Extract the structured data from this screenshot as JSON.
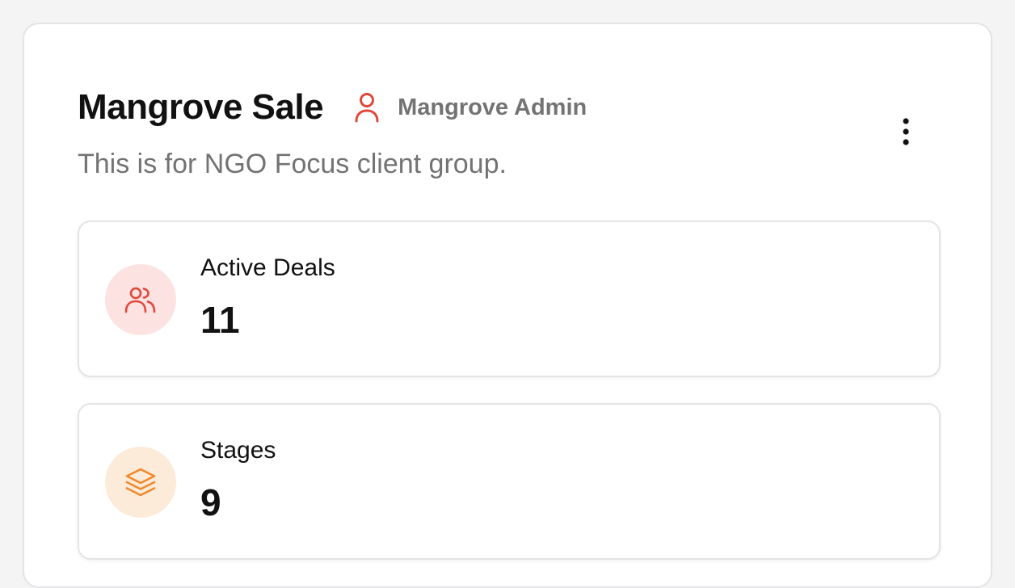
{
  "pipeline": {
    "title": "Mangrove Sale",
    "owner": "Mangrove Admin",
    "owner_icon": "user-icon",
    "description": "This is for NGO Focus client group.",
    "menu_icon": "more-vertical-icon"
  },
  "stats": [
    {
      "label": "Active Deals",
      "value": "11",
      "icon": "users-icon",
      "icon_color": "#e0483a",
      "icon_bg": "#fde2e2"
    },
    {
      "label": "Stages",
      "value": "9",
      "icon": "layers-icon",
      "icon_color": "#f0892e",
      "icon_bg": "#fdebd9"
    }
  ],
  "colors": {
    "accent_red": "#e0483a",
    "accent_orange": "#f0892e",
    "muted_text": "#737373"
  }
}
